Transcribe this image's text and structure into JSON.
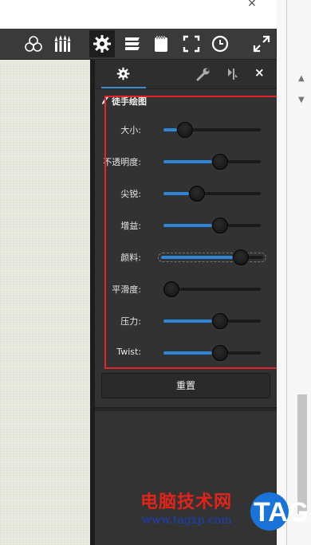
{
  "window": {
    "close_glyph": "×"
  },
  "toolbar": {
    "icons": [
      "color-circles-icon",
      "brushes-icon",
      "settings-gear-icon",
      "layers-icon",
      "notepad-icon",
      "fullscreen-icon",
      "clock-icon",
      "expand-arrows-icon"
    ],
    "active": "settings-gear-icon"
  },
  "panel": {
    "tab_icons": [
      "gear-icon",
      "wrench-icon",
      "pin-icon"
    ],
    "close_glyph": "×",
    "section_title": "徒手绘图",
    "sliders": [
      {
        "label": "大小:",
        "value": 0.14
      },
      {
        "label": "不透明度:",
        "value": 0.5
      },
      {
        "label": "尖锐:",
        "value": 0.26
      },
      {
        "label": "增益:",
        "value": 0.5
      },
      {
        "label": "颜料:",
        "value": 0.7
      },
      {
        "label": "平滑度:",
        "value": 0.0
      },
      {
        "label": "压力:",
        "value": 0.5
      },
      {
        "label": "Twist:",
        "value": 0.5
      }
    ],
    "reset_label": "重置"
  },
  "watermark": {
    "title": "电脑技术网",
    "url": "www.tagxp.com",
    "logo_text": "TAG"
  },
  "colors": {
    "accent": "#2f86d8",
    "highlight": "#e0282c",
    "panel_bg": "#323232",
    "canvas_bg": "#e9ebe1"
  }
}
